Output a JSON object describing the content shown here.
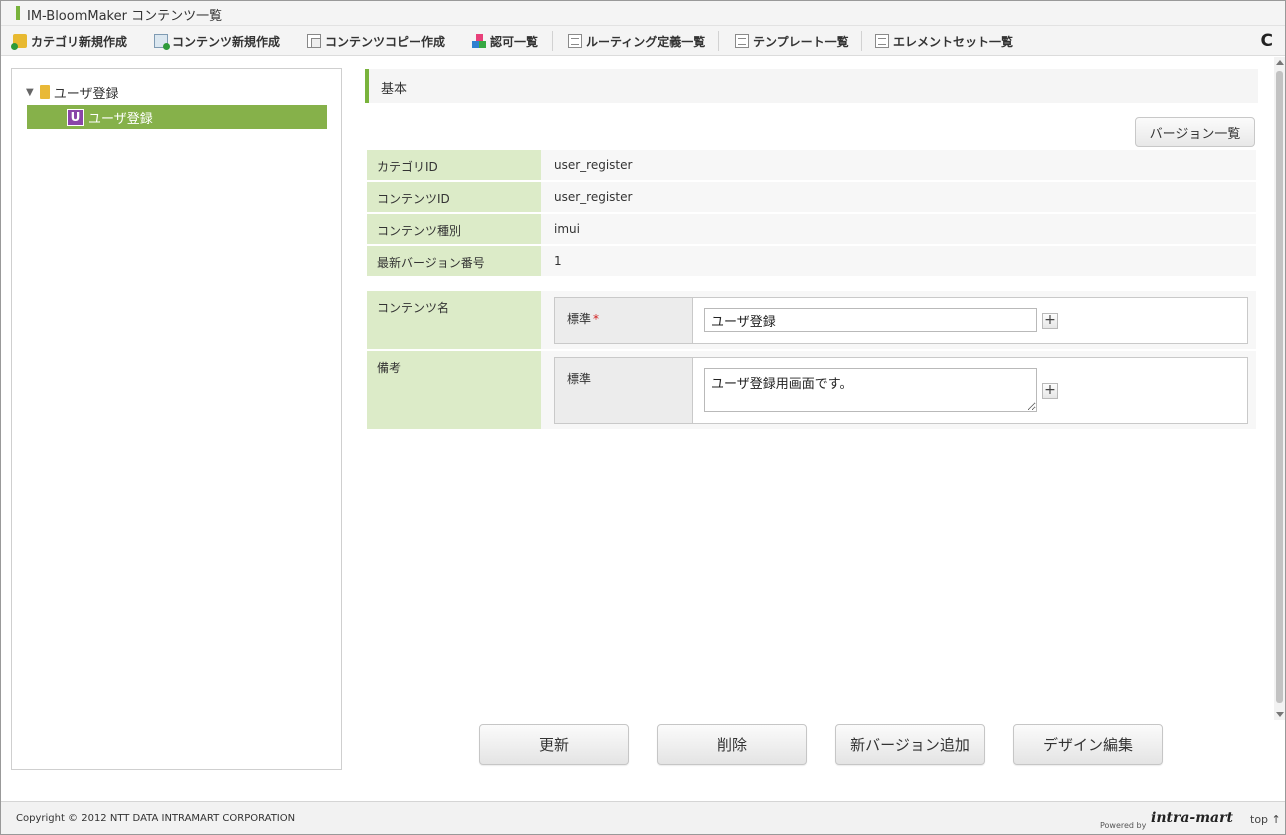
{
  "window": {
    "title": "IM-BloomMaker コンテンツ一覧"
  },
  "toolbar": {
    "items": [
      {
        "label": "カテゴリ新規作成",
        "icon": "folder-add-icon"
      },
      {
        "label": "コンテンツ新規作成",
        "icon": "document-add-icon"
      },
      {
        "label": "コンテンツコピー作成",
        "icon": "copy-icon"
      },
      {
        "label": "認可一覧",
        "icon": "blocks-icon"
      },
      {
        "label": "ルーティング定義一覧",
        "icon": "list-icon"
      },
      {
        "label": "テンプレート一覧",
        "icon": "list-icon"
      },
      {
        "label": "エレメントセット一覧",
        "icon": "list-icon"
      }
    ],
    "reload_icon": "reload-icon",
    "reload_glyph": "C"
  },
  "tree": {
    "root": {
      "label": "ユーザ登録",
      "arrow": "▼"
    },
    "selected": {
      "label": "ユーザ登録",
      "badge": "U"
    }
  },
  "section": {
    "title": "基本"
  },
  "buttons": {
    "version_list": "バージョン一覧"
  },
  "info": [
    {
      "label": "カテゴリID",
      "value": "user_register"
    },
    {
      "label": "コンテンツID",
      "value": "user_register"
    },
    {
      "label": "コンテンツ種別",
      "value": "imui"
    },
    {
      "label": "最新バージョン番号",
      "value": "1"
    }
  ],
  "fields": {
    "content_name": {
      "label": "コンテンツ名",
      "sub_label": "標準",
      "required_mark": "*",
      "value": "ユーザ登録",
      "add": "+"
    },
    "remarks": {
      "label": "備考",
      "sub_label": "標準",
      "value": "ユーザ登録用画面です。",
      "add": "+"
    }
  },
  "actions": {
    "update": "更新",
    "delete": "削除",
    "add_version": "新バージョン追加",
    "design_edit": "デザイン編集"
  },
  "footer": {
    "copyright": "Copyright © 2012 NTT DATA INTRAMART CORPORATION",
    "powered_by": "Powered by",
    "logo": "intra-mart",
    "top_link": "top ↑"
  },
  "colors": {
    "accent": "#79b33c",
    "selected_bg": "#86b14a",
    "label_bg": "#dcebc8",
    "badge": "#8a44a8"
  }
}
